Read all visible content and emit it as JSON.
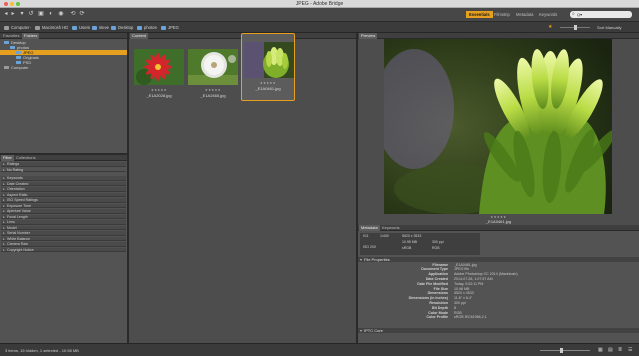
{
  "window": {
    "title": "JPEG - Adobe Bridge"
  },
  "toolbar": {
    "icons": [
      "back-arrow-icon",
      "forward-arrow-icon",
      "recent-folders-icon",
      "boomerang-icon",
      "camera-download-icon",
      "refine-icon",
      "open-in-camera-raw-icon",
      "rotate-left-icon",
      "rotate-right-icon"
    ],
    "workspaces": [
      {
        "label": "Essentials",
        "active": true
      },
      {
        "label": "Filmstrip",
        "active": false
      },
      {
        "label": "Metadata",
        "active": false
      },
      {
        "label": "Keywords",
        "active": false
      }
    ],
    "search_value": "Q▾"
  },
  "pathbar": {
    "crumbs": [
      "Computer",
      "Macintosh HD",
      "Users",
      "steve",
      "Desktop",
      "photos",
      "JPEG"
    ],
    "sort_label": "Sort Manually"
  },
  "left_panel": {
    "tabs": [
      "Favorites",
      "Folders"
    ],
    "tree": [
      {
        "label": "Desktop",
        "indent": 1,
        "selected": false
      },
      {
        "label": "photos",
        "indent": 2,
        "selected": false
      },
      {
        "label": "JPEG",
        "indent": 3,
        "selected": true
      },
      {
        "label": "Originals",
        "indent": 3,
        "selected": false
      },
      {
        "label": "PSD",
        "indent": 3,
        "selected": false
      },
      {
        "label": "Computer",
        "indent": 1,
        "selected": false
      }
    ],
    "filter_tabs": [
      "Filter",
      "Collections"
    ],
    "filters": [
      "Ratings",
      "No Rating",
      "Keywords",
      "Date Created",
      "Orientation",
      "Aspect Ratio",
      "ISO Speed Ratings",
      "Exposure Time",
      "Aperture Value",
      "Focal Length",
      "Lens",
      "Model",
      "Serial Number",
      "White Balance",
      "Camera Raw",
      "Copyright Notice"
    ]
  },
  "content": {
    "tab": "Content",
    "items": [
      {
        "name": "_E1A2028.jpg",
        "stars": "★★★★★",
        "selected": false
      },
      {
        "name": "_E1A2465.jpg",
        "stars": "★★★★★",
        "selected": false
      },
      {
        "name": "_E1A0461.jpg",
        "stars": "★★★★★",
        "selected": true
      }
    ]
  },
  "preview": {
    "tab": "Preview",
    "filename": "_E1A0461.jpg",
    "stars": "★★★★★"
  },
  "metadata": {
    "tabs": [
      "Metadata",
      "Keywords"
    ],
    "placard": {
      "aperture": "f/11",
      "shutter": "1/400",
      "dimensions": "5520 x 3533",
      "size": "10.98 MB",
      "resolution": "300 ppi",
      "iso": "ISO 200",
      "color_space": "sRGB",
      "mode": "RGB"
    },
    "sections": [
      "File Properties",
      "IPTC Core"
    ],
    "rows": [
      {
        "key": "Filename",
        "value": "_E1A0461.jpg"
      },
      {
        "key": "Document Type",
        "value": "JPEG file"
      },
      {
        "key": "Application",
        "value": "Adobe Photoshop CC 2014 (Macintosh)"
      },
      {
        "key": "Date Created",
        "value": "2014-07-28, 1:07:57 AM"
      },
      {
        "key": "Date File Modified",
        "value": "Today, 5:52:11 PM"
      },
      {
        "key": "File Size",
        "value": "10.98 MB"
      },
      {
        "key": "Dimensions",
        "value": "5520 x 3533"
      },
      {
        "key": "Dimensions (in inches)",
        "value": "11.6\" x 8.4\""
      },
      {
        "key": "Resolution",
        "value": "300 ppi"
      },
      {
        "key": "Bit Depth",
        "value": "8"
      },
      {
        "key": "Color Mode",
        "value": "RGB"
      },
      {
        "key": "Color Profile",
        "value": "sRGB IEC61966-2.1"
      }
    ]
  },
  "status": {
    "text": "3 items, 15 hidden, 1 selected - 10.98 MB"
  },
  "colors": {
    "accent": "#e6a020",
    "panel": "#535353",
    "content_bg": "#4d4d4d"
  }
}
